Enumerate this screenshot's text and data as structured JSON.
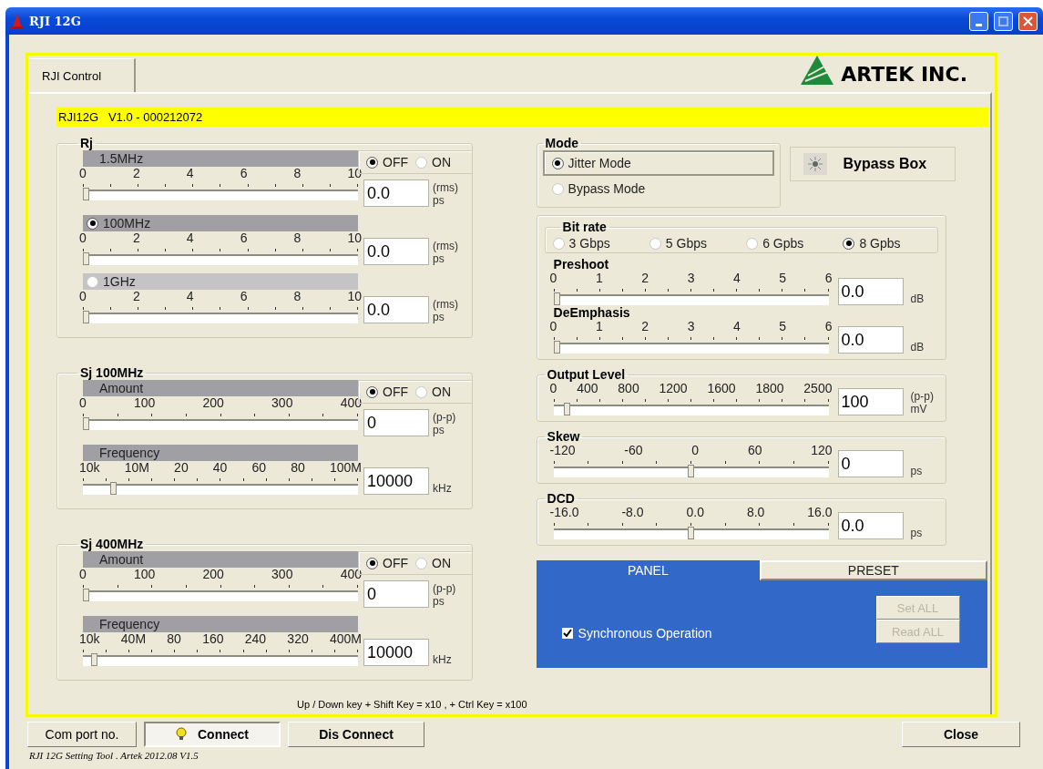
{
  "window": {
    "title": "RJI 12G"
  },
  "tab": {
    "label": "RJI Control",
    "selected": true
  },
  "logo": {
    "text": "ARTEK INC."
  },
  "info_bar": "RJI12G   V1.0 - 000212072",
  "left_groups": [
    {
      "title": "Rj",
      "switch": [
        {
          "label": "OFF",
          "selected": true
        },
        {
          "label": "ON",
          "selected": false
        }
      ],
      "rows": [
        {
          "header": {
            "label": "1.5MHz",
            "kind": "plain"
          },
          "ticks": [
            "0",
            "2",
            "4",
            "6",
            "8",
            "10"
          ],
          "level": 0,
          "value": "0.0",
          "unit": [
            "(rms)",
            "ps"
          ]
        },
        {
          "header": {
            "label": "100MHz",
            "kind": "radio",
            "selected": true
          },
          "ticks": [
            "0",
            "2",
            "4",
            "6",
            "8",
            "10"
          ],
          "level": 0,
          "value": "0.0",
          "unit": [
            "(rms)",
            "ps"
          ]
        },
        {
          "header": {
            "label": "1GHz",
            "kind": "radio",
            "selected": false
          },
          "ticks": [
            "0",
            "2",
            "4",
            "6",
            "8",
            "10"
          ],
          "level": 0,
          "value": "0.0",
          "unit": [
            "(rms)",
            "ps"
          ]
        }
      ]
    },
    {
      "title": "Sj 100MHz",
      "switch": [
        {
          "label": "OFF",
          "selected": true
        },
        {
          "label": "ON",
          "selected": false
        }
      ],
      "rows": [
        {
          "header": {
            "label": "Amount",
            "kind": "plain"
          },
          "ticks": [
            "0",
            "100",
            "200",
            "300",
            "400"
          ],
          "level": 0,
          "value": "0",
          "unit": [
            "(p-p)",
            "ps"
          ]
        },
        {
          "header": {
            "label": "Frequency",
            "kind": "plain"
          },
          "ticks": [
            "10k",
            "10M",
            "20",
            "40",
            "60",
            "80",
            "100M"
          ],
          "level": 0.1,
          "value": "10000",
          "unit": [
            "kHz"
          ]
        }
      ]
    },
    {
      "title": "Sj 400MHz",
      "switch": [
        {
          "label": "OFF",
          "selected": true
        },
        {
          "label": "ON",
          "selected": false
        }
      ],
      "rows": [
        {
          "header": {
            "label": "Amount",
            "kind": "plain"
          },
          "ticks": [
            "0",
            "100",
            "200",
            "300",
            "400"
          ],
          "level": 0,
          "value": "0",
          "unit": [
            "(p-p)",
            "ps"
          ]
        },
        {
          "header": {
            "label": "Frequency",
            "kind": "plain"
          },
          "ticks": [
            "10k",
            "40M",
            "80",
            "160",
            "240",
            "320",
            "400M"
          ],
          "level": 0.03,
          "value": "10000",
          "unit": [
            "kHz"
          ]
        }
      ]
    }
  ],
  "hint": "Up / Down key + Shift Key = x10 , + Ctrl Key = x100",
  "mode": {
    "title": "Mode",
    "options": [
      {
        "label": "Jitter Mode",
        "selected": true
      },
      {
        "label": "Bypass Mode",
        "selected": false
      }
    ]
  },
  "bypass_button": {
    "label": "Bypass Box"
  },
  "bit_rate": {
    "title": "Bit rate",
    "options": [
      {
        "label": "3 Gbps",
        "selected": false
      },
      {
        "label": "5 Gbps",
        "selected": false
      },
      {
        "label": "6 Gpbs",
        "selected": false
      },
      {
        "label": "8 Gpbs",
        "selected": true
      }
    ],
    "sliders": [
      {
        "title": "Preshoot",
        "ticks": [
          "0",
          "1",
          "2",
          "3",
          "4",
          "5",
          "6"
        ],
        "level": 0,
        "value": "0.0",
        "unit": [
          "dB"
        ]
      },
      {
        "title": "DeEmphasis",
        "ticks": [
          "0",
          "1",
          "2",
          "3",
          "4",
          "5",
          "6"
        ],
        "level": 0,
        "value": "0.0",
        "unit": [
          "dB"
        ]
      }
    ]
  },
  "level_groups": [
    {
      "title": "Output Level",
      "ticks": [
        "0",
        "400",
        "800",
        "1200",
        "1600",
        "1800",
        "2500"
      ],
      "level": 0.04,
      "value": "100",
      "unit": [
        "(p-p)",
        "mV"
      ]
    },
    {
      "title": "Skew",
      "ticks": [
        "-120",
        "-60",
        "0",
        "60",
        "120"
      ],
      "level": 0.5,
      "value": "0",
      "unit": [
        "ps"
      ]
    },
    {
      "title": "DCD",
      "ticks": [
        "-16.0",
        "-8.0",
        "0.0",
        "8.0",
        "16.0"
      ],
      "level": 0.5,
      "value": "0.0",
      "unit": [
        "ps"
      ]
    }
  ],
  "panel": {
    "tabs": [
      {
        "label": "PANEL",
        "selected": true
      },
      {
        "label": "PRESET",
        "selected": false
      }
    ],
    "sync": {
      "label": "Synchronous Operation",
      "checked": true
    },
    "buttons": [
      {
        "label": "Set ALL",
        "disabled": true
      },
      {
        "label": "Read ALL",
        "disabled": true
      }
    ]
  },
  "bottom_buttons": [
    {
      "label": "Com port no.",
      "kind": "plain"
    },
    {
      "label": "Connect",
      "kind": "lamp",
      "pressed": true
    },
    {
      "label": "Dis Connect",
      "kind": "strong"
    }
  ],
  "close_button": {
    "label": "Close"
  },
  "status": "RJI 12G Setting Tool . Artek 2012.08 V1.5"
}
